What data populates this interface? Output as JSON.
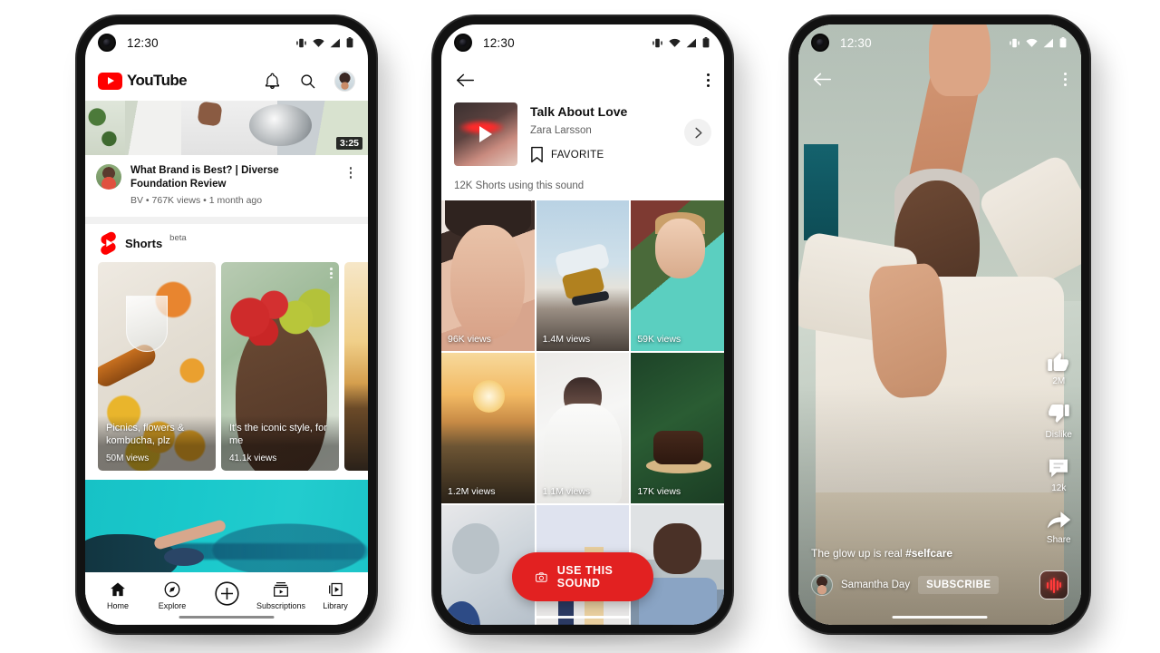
{
  "status_bar": {
    "time": "12:30",
    "icons": [
      "vibrate-icon",
      "wifi-icon",
      "signal-icon",
      "battery-icon"
    ]
  },
  "phone1": {
    "app_bar": {
      "logo_text": "YouTube",
      "notifications_label": "bell-icon",
      "search_label": "search-icon",
      "avatar_label": "account-avatar"
    },
    "featured_video": {
      "duration": "3:25",
      "title": "What Brand is Best? | Diverse Foundation Review",
      "meta": "BV • 767K views • 1 month ago"
    },
    "shorts_shelf": {
      "title": "Shorts",
      "badge": "beta",
      "cards": [
        {
          "title": "Picnics, flowers & kombucha, plz",
          "views": "50M views"
        },
        {
          "title": "It's the iconic style, for me",
          "views": "41.1k views"
        },
        {
          "title": "",
          "views": ""
        }
      ]
    },
    "tabs": [
      {
        "label": "Home",
        "icon": "home-icon"
      },
      {
        "label": "Explore",
        "icon": "compass-icon"
      },
      {
        "label": "",
        "icon": "plus-circle-icon"
      },
      {
        "label": "Subscriptions",
        "icon": "subscriptions-icon"
      },
      {
        "label": "Library",
        "icon": "library-icon"
      }
    ]
  },
  "phone2": {
    "back_label": "back-arrow-icon",
    "overflow_label": "more-options-icon",
    "sound": {
      "title": "Talk About Love",
      "artist": "Zara Larsson",
      "favorite_label": "FAVORITE",
      "chevron_label": "chevron-right-icon"
    },
    "count_line": "12K Shorts using this sound",
    "grid": [
      {
        "views": "96K views"
      },
      {
        "views": "1.4M views"
      },
      {
        "views": "59K views"
      },
      {
        "views": "1.2M views"
      },
      {
        "views": "1.1M views"
      },
      {
        "views": "17K views"
      },
      {
        "views": ""
      },
      {
        "views": ""
      },
      {
        "views": ""
      }
    ],
    "cta": {
      "label": "USE THIS SOUND",
      "icon": "camera-icon",
      "color": "#e22121"
    }
  },
  "phone3": {
    "back_label": "back-arrow-icon",
    "overflow_label": "more-options-icon",
    "rail": [
      {
        "icon": "thumbs-up-icon",
        "label": "2M"
      },
      {
        "icon": "thumbs-down-icon",
        "label": "Dislike"
      },
      {
        "icon": "comment-icon",
        "label": "12k"
      },
      {
        "icon": "share-icon",
        "label": "Share"
      }
    ],
    "caption_prefix": "The glow up is real ",
    "caption_tag": "#selfcare",
    "channel": "Samantha Day",
    "subscribe_label": "SUBSCRIBE",
    "sound_disc_label": "sound-disc-icon"
  }
}
